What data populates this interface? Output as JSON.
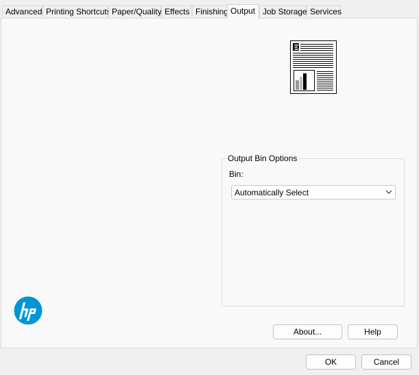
{
  "tabs": [
    {
      "label": "Advanced",
      "active": false
    },
    {
      "label": "Printing Shortcuts",
      "active": false
    },
    {
      "label": "Paper/Quality",
      "active": false
    },
    {
      "label": "Effects",
      "active": false
    },
    {
      "label": "Finishing",
      "active": false
    },
    {
      "label": "Output",
      "active": true
    },
    {
      "label": "Job Storage",
      "active": false
    },
    {
      "label": "Services",
      "active": false
    }
  ],
  "output_bin": {
    "group_title": "Output Bin Options",
    "bin_label": "Bin:",
    "bin_selected": "Automatically Select"
  },
  "buttons": {
    "about": "About...",
    "help": "Help",
    "ok": "OK",
    "cancel": "Cancel"
  },
  "icons": {
    "preview": "document-preview-icon",
    "logo": "hp-logo-icon",
    "dropdown": "chevron-down-icon"
  },
  "colors": {
    "hp_blue": "#0096d6",
    "window_bg": "#f0f0f0",
    "panel_bg": "#f9f9f9"
  }
}
